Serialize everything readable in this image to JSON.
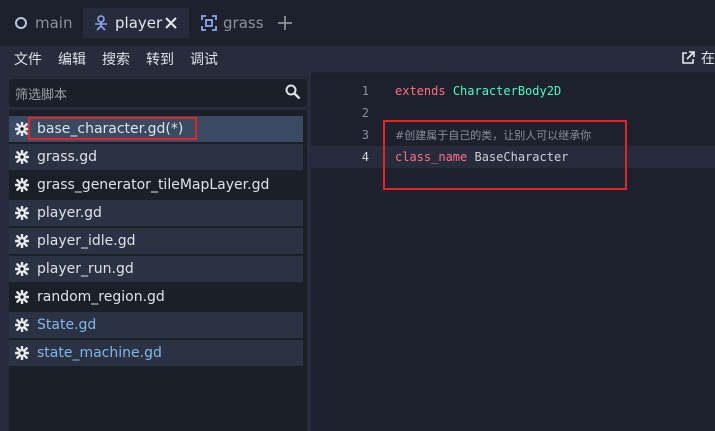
{
  "tabs": [
    {
      "label": "main",
      "icon": "scene-circle-icon"
    },
    {
      "label": "player",
      "icon": "character-node-icon"
    },
    {
      "label": "grass",
      "icon": "tilemap-node-icon"
    }
  ],
  "menu": {
    "items": [
      "文件",
      "编辑",
      "搜索",
      "转到",
      "调试"
    ],
    "right_label": "在"
  },
  "script_list": {
    "filter_placeholder": "筛选脚本",
    "files": [
      "base_character.gd(*)",
      "grass.gd",
      "grass_generator_tileMapLayer.gd",
      "player.gd",
      "player_idle.gd",
      "player_run.gd",
      "random_region.gd",
      "State.gd",
      "state_machine.gd"
    ]
  },
  "editor": {
    "lines": [
      {
        "number": "1",
        "keyword": "extends",
        "type": "CharacterBody2D"
      },
      {
        "number": "2"
      },
      {
        "number": "3",
        "comment": "#创建属于自己的类，让别人可以继承你"
      },
      {
        "number": "4",
        "keyword": "class_name",
        "value": "BaseCharacter"
      }
    ]
  },
  "colors": {
    "keyword": "#ff7085",
    "type": "#42ffc2",
    "highlight_box": "#e02626",
    "class_script": "#7fb7e7"
  }
}
